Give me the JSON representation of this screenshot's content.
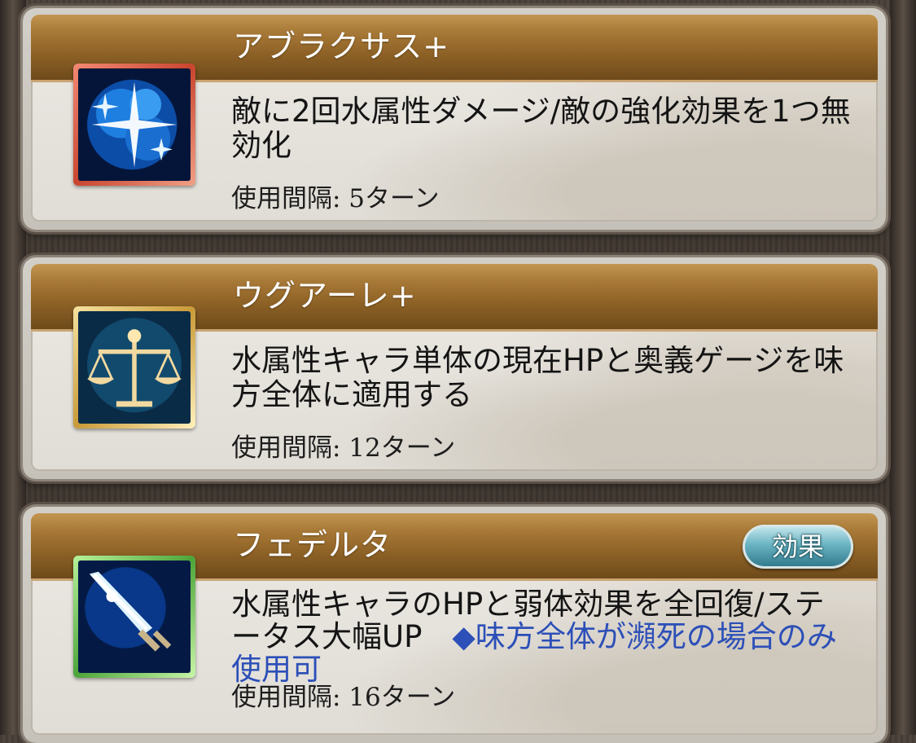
{
  "skills": [
    {
      "name": "アブラクサス+",
      "description": "敵に2回水属性ダメージ/敵の強化効果を1つ無効化",
      "note": "",
      "cooldown": "使用間隔: 5ターン",
      "icon": "blue-crystal-sparkle-icon",
      "frame_color": "#d9553c"
    },
    {
      "name": "ウグアーレ+",
      "description": "水属性キャラ単体の現在HPと奥義ゲージを味方全体に適用する",
      "note": "",
      "cooldown": "使用間隔: 12ターン",
      "icon": "balance-scale-icon",
      "frame_color": "#d8b04a"
    },
    {
      "name": "フェデルタ",
      "description": "水属性キャラのHPと弱体効果を全回復/ステータス大幅UP",
      "note": "◆味方全体が瀕死の場合のみ使用可",
      "cooldown": "使用間隔: 16ターン",
      "icon": "glowing-sword-icon",
      "frame_color": "#5fbf45",
      "effect_button": "効果"
    }
  ]
}
